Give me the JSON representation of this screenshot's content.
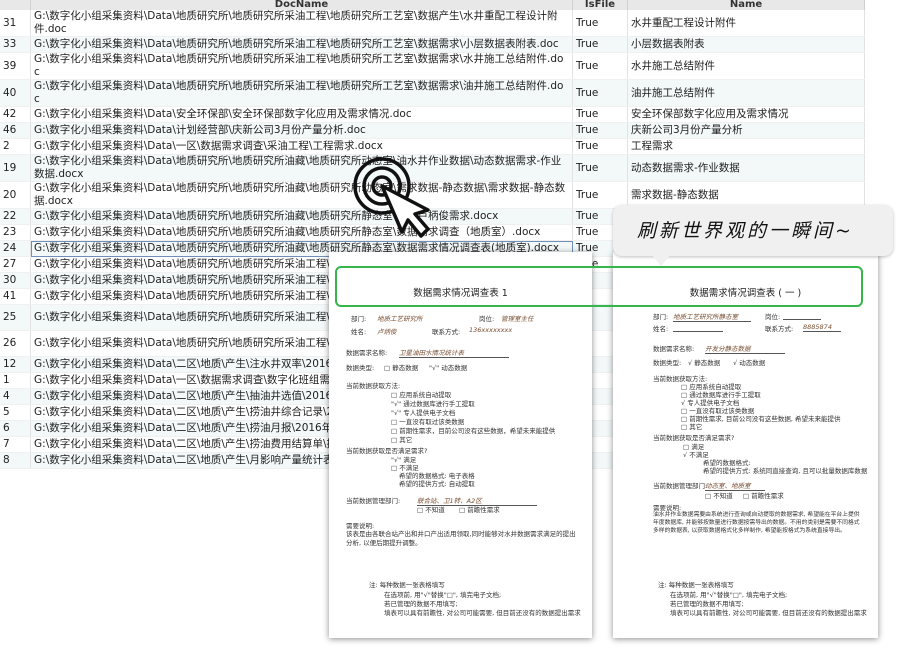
{
  "table": {
    "headers": [
      "",
      "DocName",
      "IsFile",
      "Name"
    ],
    "rows": [
      {
        "id": "31",
        "doc": "G:\\数字化小组采集资料\\Data\\地质研究所\\地质研究所采油工程\\地质研究所工艺室\\数据产生\\水井重配工程设计附件.doc",
        "isfile": "True",
        "name": "水井重配工程设计附件"
      },
      {
        "id": "33",
        "doc": "G:\\数字化小组采集资料\\Data\\地质研究所\\地质研究所采油工程\\地质研究所工艺室\\数据需求\\小层数据表附表.doc",
        "isfile": "True",
        "name": "小层数据表附表"
      },
      {
        "id": "39",
        "doc": "G:\\数字化小组采集资料\\Data\\地质研究所\\地质研究所采油工程\\地质研究所工艺室\\数据需求\\水井施工总结附件.doc",
        "isfile": "True",
        "name": "水井施工总结附件"
      },
      {
        "id": "40",
        "doc": "G:\\数字化小组采集资料\\Data\\地质研究所\\地质研究所采油工程\\地质研究所工艺室\\数据需求\\油井施工总结附件.doc",
        "isfile": "True",
        "name": "油井施工总结附件"
      },
      {
        "id": "42",
        "doc": "G:\\数字化小组采集资料\\Data\\安全环保部\\安全环保部数字化应用及需求情况.doc",
        "isfile": "True",
        "name": "安全环保部数字化应用及需求情况"
      },
      {
        "id": "46",
        "doc": "G:\\数字化小组采集资料\\Data\\计划经营部\\庆新公司3月份产量分析.doc",
        "isfile": "True",
        "name": "庆新公司3月份产量分析"
      },
      {
        "id": "2",
        "doc": "G:\\数字化小组采集资料\\Data\\一区\\数据需求调查\\采油工程\\工程需求.docx",
        "isfile": "True",
        "name": "工程需求"
      },
      {
        "id": "19",
        "doc": "G:\\数字化小组采集资料\\Data\\地质研究所\\地质研究所油藏\\地质研究所动态室\\油水井作业数据\\动态数据需求-作业数据.docx",
        "isfile": "True",
        "name": "动态数据需求-作业数据"
      },
      {
        "id": "20",
        "doc": "G:\\数字化小组采集资料\\Data\\地质研究所\\地质研究所油藏\\地质研究所动态室\\需求数据-静态数据\\需求数据-静态数据.docx",
        "isfile": "True",
        "name": "需求数据-静态数据"
      },
      {
        "id": "22",
        "doc": "G:\\数字化小组采集资料\\Data\\地质研究所\\地质研究所油藏\\地质研究所静态室\\地质卢柄俊需求.docx",
        "isfile": "True",
        "name": "地质卢柄俊需求"
      },
      {
        "id": "23",
        "doc": "G:\\数字化小组采集资料\\Data\\地质研究所\\地质研究所油藏\\地质研究所静态室\\数据需求调查（地质室）.docx",
        "isfile": "True",
        "name": ""
      },
      {
        "id": "24",
        "doc": "G:\\数字化小组采集资料\\Data\\地质研究所\\地质研究所油藏\\地质研究所静态室\\数据需求情况调查表(地质室).docx",
        "isfile": "True",
        "name": ""
      },
      {
        "id": "27",
        "doc": "G:\\数字化小组采集资料\\Data\\地质研究所\\地质研究所采油工程\\地质研究所工艺室\\数据产生\\射孔工程设计附件.jpg",
        "isfile": "True",
        "name": ""
      },
      {
        "id": "30",
        "doc": "G:\\数字化小组采集资料\\Data\\地质研究所\\地质研究所采油工程\\地",
        "isfile": "",
        "name": ""
      },
      {
        "id": "41",
        "doc": "G:\\数字化小组采集资料\\Data\\地质研究所\\地质研究所采油工程\\地",
        "isfile": "",
        "name": ""
      },
      {
        "id": "25",
        "doc": "G:\\数字化小组采集资料\\Data\\地质研究所\\地质研究所采油工程\\地 井设备年度计划截图.png",
        "isfile": "",
        "name": ""
      },
      {
        "id": "26",
        "doc": "G:\\数字化小组采集资料\\Data\\地质研究所\\地质研究所采油工程\\地 井设备年度计划截图.png",
        "isfile": "",
        "name": ""
      },
      {
        "id": "12",
        "doc": "G:\\数字化小组采集资料\\Data\\二区\\地质\\产生\\注水井双率\\2016年",
        "isfile": "",
        "name": ""
      },
      {
        "id": "1",
        "doc": "G:\\数字化小组采集资料\\Data\\一区\\数据需求调查\\数字化班组需求",
        "isfile": "",
        "name": ""
      },
      {
        "id": "4",
        "doc": "G:\\数字化小组采集资料\\Data\\二区\\地质\\产生\\抽油井选值\\2016年",
        "isfile": "",
        "name": ""
      },
      {
        "id": "5",
        "doc": "G:\\数字化小组采集资料\\Data\\二区\\地质\\产生\\捞油井综合记录\\2",
        "isfile": "",
        "name": ""
      },
      {
        "id": "6",
        "doc": "G:\\数字化小组采集资料\\Data\\二区\\地质\\产生\\捞油月报\\2016年",
        "isfile": "",
        "name": ""
      },
      {
        "id": "7",
        "doc": "G:\\数字化小组采集资料\\Data\\二区\\地质\\产生\\捞油费用结算单\\捞",
        "isfile": "",
        "name": ""
      },
      {
        "id": "8",
        "doc": "G:\\数字化小组采集资料\\Data\\二区\\地质\\产生\\月影响产量统计表",
        "isfile": "",
        "name": ""
      }
    ]
  },
  "banner": {
    "text": "刷新世界观的一瞬间~"
  },
  "doc_left": {
    "title": "数据需求情况调查表 1",
    "dept_label": "部门:",
    "dept_value": "地质工艺研究所",
    "post_label": "岗位:",
    "post_value": "管理室主任",
    "name_label": "姓名:",
    "name_value": "卢炳俊",
    "contact_label": "联系方式:",
    "contact_value": "136xxxxxxxx",
    "req_name_label": "数据需求名称:",
    "req_name_value": "卫星油田水情况统计表",
    "type_label": "数据类型:",
    "type_static": "□ 静态数据",
    "type_dynamic": "\"√\" 动态数据",
    "current_method_label": "当前数据获取方法:",
    "methods": [
      "□ 应用系统自动提取",
      "\"√\" 通过数据库进行手工提取",
      "\"√\" 专人提供电子文档",
      "□ 一直没有取过该类数据",
      "□ 前期性需求，目前公司没有这些数据，希望未来能提供",
      "□ 其它"
    ],
    "satisfy_label": "当前数据获取是否满足需求?",
    "satisfy_yes": "\"√\" 满足",
    "satisfy_no": "□ 不满足",
    "wish_format": "希望的数据格式: 电子表格",
    "wish_method": "希望的提供方式: 自动提取",
    "admin_label": "当前数据管理部门:",
    "admin_value": "联合站、卫1转、A2区",
    "admin_unknown": "□ 不知道",
    "admin_future": "□ 前瞻性需求",
    "note_label": "需要说明:",
    "note_text": "该表是由各联合站产出和井口产出适用领取,同时能够对水井数据需求满足的提出分析, 以便后期提升调整。",
    "footer_label": "注: 每种数据一张表格填写",
    "footer_lines": [
      "在选项前, 用\"√\"替换\"□\", 填完电子文档;",
      "若已管理的数据不用填写;",
      "填表可以具有前瞻性, 对公司可能需要, 但目前还没有的数据提出需求"
    ]
  },
  "doc_right": {
    "title": "数据需求情况调查表 ( 一 )",
    "dept_label": "部门:",
    "dept_value": "地质工艺研究所静态室",
    "post_label": "岗位:",
    "name_label": "姓名:",
    "contact_label": "联系方式:",
    "contact_value": "8885874",
    "req_name_label": "数据需求名称:",
    "req_name_value": "开发分静态数据",
    "type_label": "数据类型:",
    "type_static": "√ 静态数据",
    "type_dynamic": "√ 动态数据",
    "current_method_label": "当前数据获取方法:",
    "methods": [
      "□ 应用系统自动提取",
      "□ 通过数据库进行手工提取",
      "√ 专人提供电子文档",
      "□ 一直没有取过该类数据",
      "□ 前期性需求, 目前公司没有这些数据, 希望未来能提供",
      "□ 其它"
    ],
    "satisfy_label": "当前数据获取是否满足需求?",
    "satisfy_yes": "□ 满足",
    "satisfy_no": "√ 不满足",
    "wish_format": "希望的数据格式:",
    "wish_method": "希望的提供方式: 系统同直接查询, 且可以批量数据库数据",
    "admin_label": "当前数据管理部门:",
    "admin_value": "动态室、地质室",
    "admin_unknown": "□ 不知道",
    "admin_future": "□ 前瞻性需求",
    "note_label": "需要说明:",
    "note_text": "油水井作业数据需要由系统进行查询或自动提取的数据需求, 希望能在平台上提供年度数据库, 并能够按数量进行数据按需导出的数据。不用的类别是需要不同格式多样的数据表, 以获取数据格式化多样制作, 希望能按格式为系统直接导出。",
    "footer_label": "注: 每种数据一张表格填写",
    "footer_lines": [
      "在选项前, 用\"√\"替换\"□\", 填完电子文档;",
      "若已管理的数据不用填写;",
      "填表可以具有前瞻性, 对公司可能需要, 但目前还没有的数据提出需求"
    ]
  }
}
